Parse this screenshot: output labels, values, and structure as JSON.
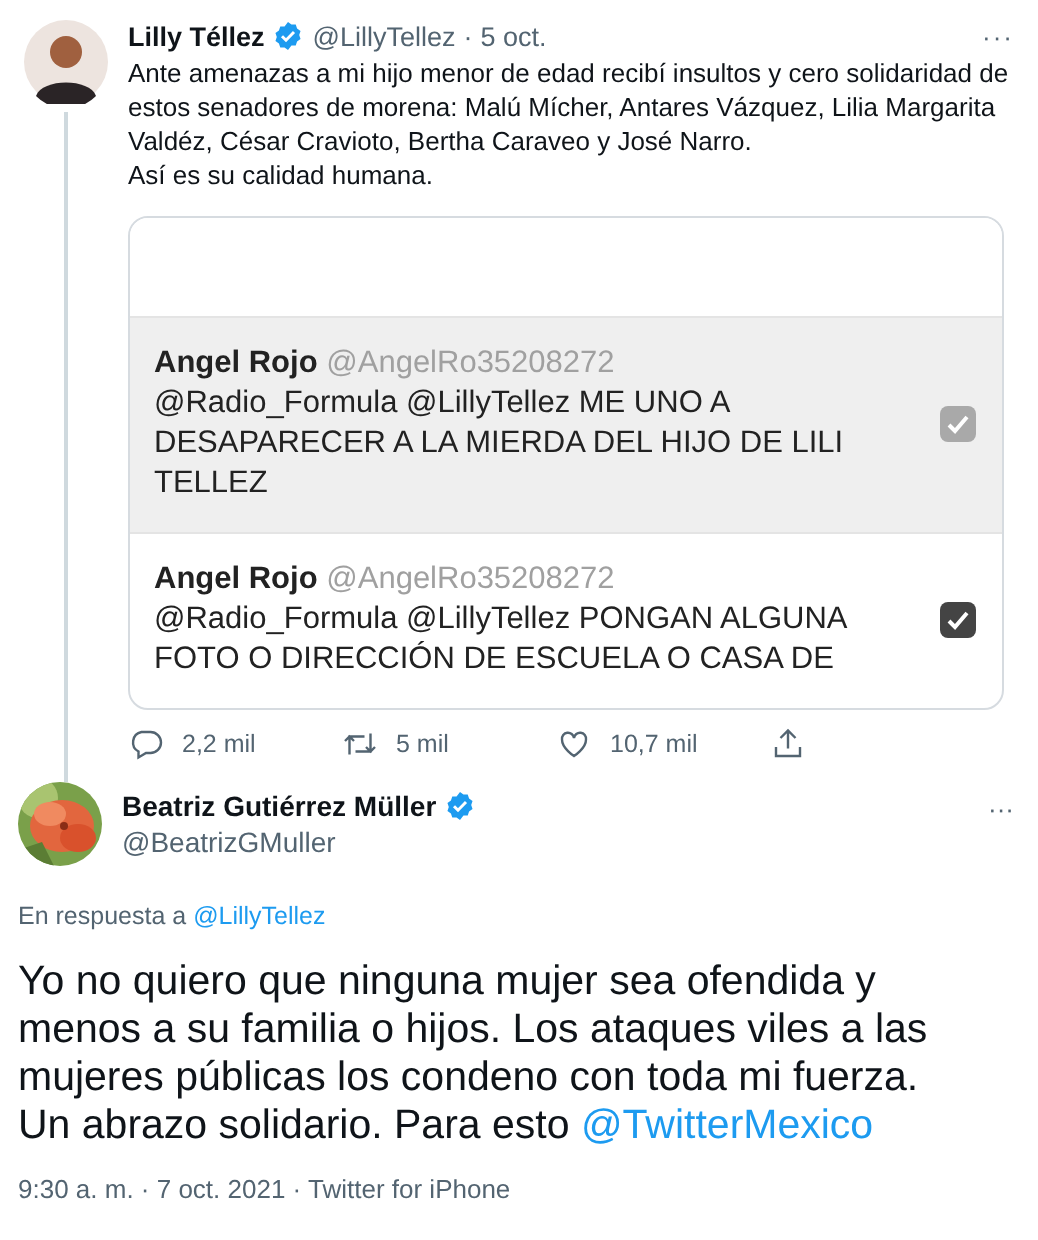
{
  "tweet": {
    "name": "Lilly Téllez",
    "handle": "@LillyTellez",
    "separator": "·",
    "time": "5 oct.",
    "more": "···",
    "text": "Ante amenazas a mi hijo menor de edad recibí insultos y cero solidaridad de estos senadores de morena: Malú Mícher, Antares Vázquez, Lilia Margarita Valdéz, César Cravioto, Bertha Caraveo y José Narro.\nAsí es su calidad humana.",
    "image": {
      "rows": [
        {
          "name": "Angel Rojo",
          "handle": "@AngelRo35208272",
          "text": "@Radio_Formula @LillyTellez ME UNO A DESAPARECER A LA MIERDA DEL HIJO DE LILI TELLEZ",
          "selected": true,
          "kind": "faded"
        },
        {
          "name": "Angel Rojo",
          "handle": "@AngelRo35208272",
          "text": "@Radio_Formula @LillyTellez PONGAN ALGUNA FOTO O DIRECCIÓN DE ESCUELA O CASA DE",
          "selected": false,
          "kind": "dark"
        }
      ]
    },
    "actions": [
      {
        "kind": "reply",
        "count": "2,2 mil"
      },
      {
        "kind": "retweet",
        "count": "5 mil"
      },
      {
        "kind": "like",
        "count": "10,7 mil"
      },
      {
        "kind": "share"
      }
    ]
  },
  "reply": {
    "name": "Beatriz Gutiérrez Müller",
    "handle": "@BeatrizGMuller",
    "more": "···",
    "replying_to": "En respuesta a",
    "replying_link": "@LillyTellez",
    "text": "Yo no quiero que ninguna mujer sea ofendida y menos a su familia o hijos. Los ataques viles a las mujeres públicas los condeno con toda mi fuerza. Un abrazo solidario. Para esto",
    "text_link": "@TwitterMexico",
    "meta": "9:30 a. m. · 7 oct. 2021 · Twitter for iPhone"
  }
}
